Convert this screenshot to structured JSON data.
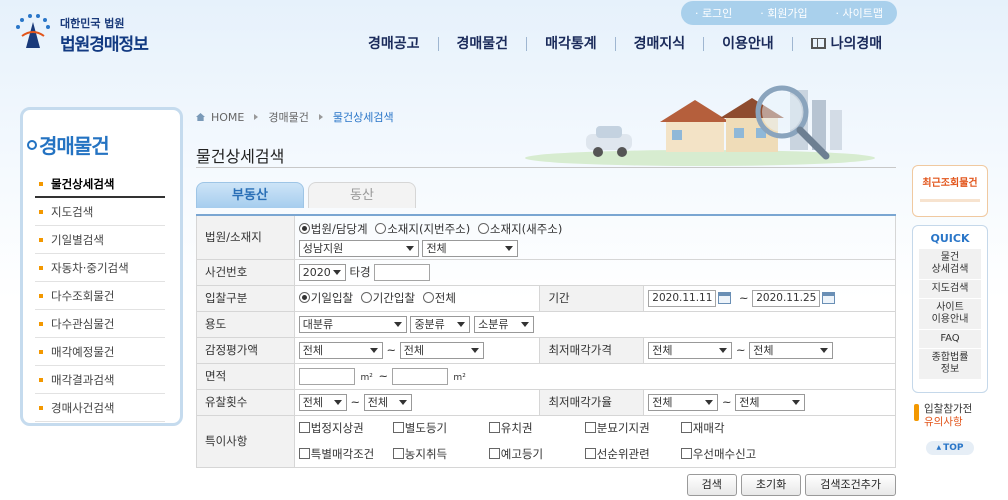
{
  "header": {
    "logo_small": "대한민국 법원",
    "logo_big": "법원경매정보",
    "util_links": [
      "로그인",
      "회원가입",
      "사이트맵"
    ],
    "gnb": [
      "경매공고",
      "경매물건",
      "매각통계",
      "경매지식",
      "이용안내",
      "나의경매"
    ]
  },
  "sidebar": {
    "title": "경매물건",
    "items": [
      {
        "label": "물건상세검색",
        "active": true
      },
      {
        "label": "지도검색"
      },
      {
        "label": "기일별검색"
      },
      {
        "label": "자동차·중기검색"
      },
      {
        "label": "다수조회물건"
      },
      {
        "label": "다수관심물건"
      },
      {
        "label": "매각예정물건"
      },
      {
        "label": "매각결과검색"
      },
      {
        "label": "경매사건검색"
      }
    ]
  },
  "breadcrumb": [
    "HOME",
    "경매물건",
    "물건상세검색"
  ],
  "page_title": "물건상세검색",
  "tabs": [
    "부동산",
    "동산"
  ],
  "form": {
    "court": {
      "label": "법원/소재지",
      "options": [
        "법원/담당계",
        "소재지(지번주소)",
        "소재지(새주소)"
      ],
      "court_select": "성남지원",
      "dept_select": "전체"
    },
    "case": {
      "label": "사건번호",
      "year": "2020",
      "suffix": "타경"
    },
    "bid": {
      "label": "입찰구분",
      "options": [
        "기일입찰",
        "기간입찰",
        "전체"
      ],
      "period_label": "기간",
      "date_from": "2020.11.11",
      "date_to": "2020.11.25"
    },
    "usage": {
      "label": "용도",
      "selects": [
        "대분류",
        "중분류",
        "소분류"
      ]
    },
    "appraisal": {
      "label": "감정평가액",
      "from": "전체",
      "to": "전체",
      "min_label": "최저매각가격",
      "min_from": "전체",
      "min_to": "전체"
    },
    "area": {
      "label": "면적",
      "unit": "m²"
    },
    "fail": {
      "label": "유찰횟수",
      "from": "전체",
      "to": "전체",
      "rate_label": "최저매각가율",
      "rate_from": "전체",
      "rate_to": "전체"
    },
    "special": {
      "label": "특이사항",
      "items": [
        "법정지상권",
        "별도등기",
        "유치권",
        "분묘기지권",
        "재매각",
        "특별매각조건",
        "농지취득",
        "예고등기",
        "선순위관련",
        "우선매수신고"
      ]
    },
    "tilde": "~"
  },
  "buttons": [
    "검색",
    "초기화",
    "검색조건추가"
  ],
  "right": {
    "recent": "최근조회물건",
    "quick_title": "QUICK",
    "quick_items": [
      "물건\n상세검색",
      "지도검색",
      "사이트\n이용안내",
      "FAQ",
      "종합법률\n정보"
    ],
    "caution_1": "입찰참가전",
    "caution_2": "유의사항",
    "top": "TOP"
  }
}
